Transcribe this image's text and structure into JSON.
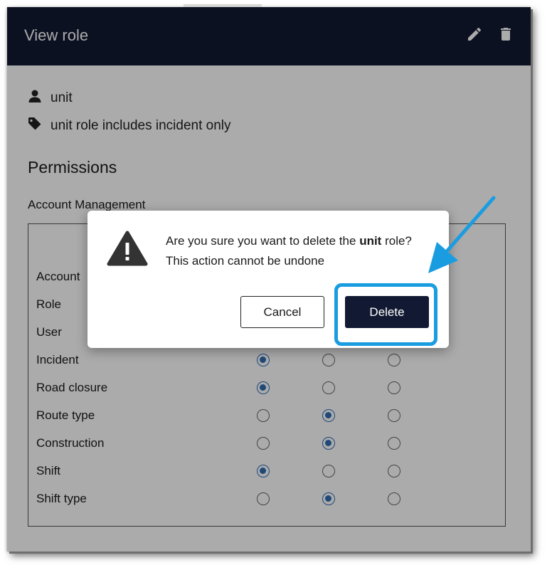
{
  "header": {
    "title": "View role",
    "edit_icon": "pencil-icon",
    "delete_icon": "trash-icon"
  },
  "role": {
    "name": "unit",
    "description": "unit role includes incident only",
    "name_icon": "user-icon",
    "description_icon": "tag-icon"
  },
  "permissions": {
    "title": "Permissions",
    "section_title": "Account Management",
    "rows": [
      {
        "label": "Account",
        "selected": 0
      },
      {
        "label": "Role",
        "selected": 0
      },
      {
        "label": "User",
        "selected": 0
      },
      {
        "label": "Incident",
        "selected": 0
      },
      {
        "label": "Road closure",
        "selected": 0
      },
      {
        "label": "Route type",
        "selected": 1
      },
      {
        "label": "Construction",
        "selected": 1
      },
      {
        "label": "Shift",
        "selected": 0
      },
      {
        "label": "Shift type",
        "selected": 1
      }
    ]
  },
  "dialog": {
    "message_prefix": "Are you sure you want to delete the",
    "message_role": "unit",
    "message_suffix": "role?",
    "message_line2": "This action cannot be undone",
    "cancel_label": "Cancel",
    "delete_label": "Delete",
    "icon": "warning-icon"
  },
  "annotation": {
    "color": "#1a9de0",
    "arrow_icon": "arrow-icon"
  },
  "colors": {
    "header_bg": "#121a33",
    "radio_selected": "#2f6db5",
    "primary_button": "#121a33"
  }
}
